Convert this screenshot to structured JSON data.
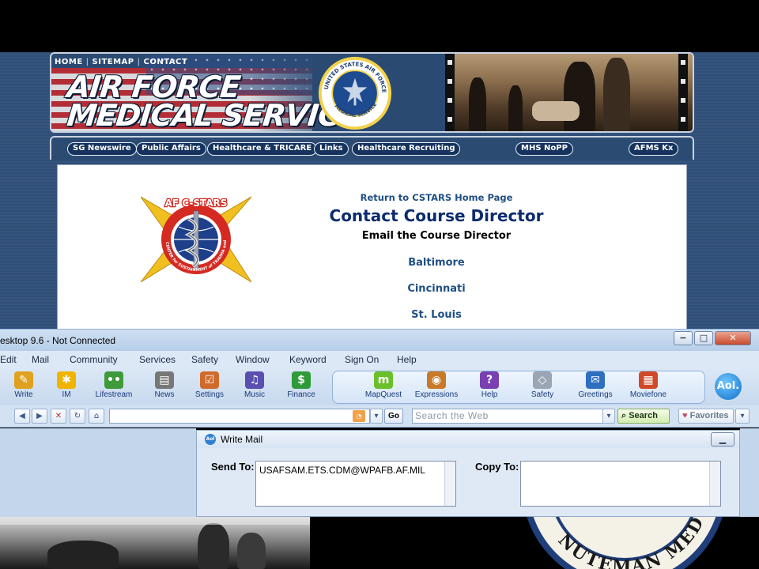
{
  "site": {
    "top_nav": [
      "HOME",
      "SITEMAP",
      "CONTACT"
    ],
    "brand_line1": "AIR FORCE",
    "brand_line2": "MEDICAL SERVICE",
    "seal_text": "UNITED STATES AIR FORCE · MEDICAL SERVICE",
    "nav_pills": [
      "SG Newswire",
      "Public Affairs",
      "Healthcare & TRICARE",
      "Links",
      "Healthcare Recruiting",
      "MHS NoPP",
      "AFMS Kx"
    ],
    "cstars_logo_text": "AF C-STARS",
    "cstars_ring_text": "CENTER for SUSTAINMENT of TRAUMA and READINESS SKILLS",
    "return_link": "Return to CSTARS Home Page",
    "contact_title": "Contact Course Director",
    "email_label": "Email the Course Director",
    "cities": [
      "Baltimore",
      "Cincinnati",
      "St. Louis"
    ]
  },
  "aol": {
    "title": "esktop 9.6 - Not Connected",
    "window_buttons": {
      "minimize": "−",
      "maximize": "□",
      "close": "✕"
    },
    "menu": [
      "Edit",
      "Mail",
      "Community",
      "Services",
      "Safety",
      "Window",
      "Keyword",
      "Sign On",
      "Help"
    ],
    "tools_left": [
      {
        "label": "Write",
        "icon": "write-icon",
        "color": "#e0a020",
        "glyph": "✎"
      },
      {
        "label": "IM",
        "icon": "running-man-icon",
        "color": "#f0b400",
        "glyph": "✱"
      },
      {
        "label": "Lifestream",
        "icon": "lifestream-icon",
        "color": "#3f9a3a",
        "glyph": "••"
      },
      {
        "label": "News",
        "icon": "news-icon",
        "color": "#777777",
        "glyph": "▤"
      },
      {
        "label": "Settings",
        "icon": "settings-icon",
        "color": "#d06a2a",
        "glyph": "☑"
      },
      {
        "label": "Music",
        "icon": "headphones-icon",
        "color": "#5a4fb0",
        "glyph": "♫"
      },
      {
        "label": "Finance",
        "icon": "finance-icon",
        "color": "#2f9a3a",
        "glyph": "$"
      }
    ],
    "tools_right": [
      {
        "label": "MapQuest",
        "icon": "mapquest-icon",
        "color": "#6bbf2a",
        "glyph": "m"
      },
      {
        "label": "Expressions",
        "icon": "palette-icon",
        "color": "#c87a2a",
        "glyph": "◉"
      },
      {
        "label": "Help",
        "icon": "help-icon",
        "color": "#7a3fb0",
        "glyph": "?"
      },
      {
        "label": "Safety",
        "icon": "shield-icon",
        "color": "#9aa6b4",
        "glyph": "◇"
      },
      {
        "label": "Greetings",
        "icon": "greetings-icon",
        "color": "#2f6fc0",
        "glyph": "✉"
      },
      {
        "label": "Moviefone",
        "icon": "popcorn-icon",
        "color": "#d04a2a",
        "glyph": "▦"
      }
    ],
    "logo": "Aol.",
    "go_label": "Go",
    "search_placeholder": "Search the Web",
    "search_button": "Search",
    "favorites_button": "Favorites",
    "write_mail": {
      "title": "Write Mail",
      "send_to_label": "Send To:",
      "send_to_value": "USAFSAM.ETS.CDM@WPAFB.AF.MIL",
      "copy_to_label": "Copy To:",
      "copy_to_value": ""
    }
  },
  "bottom_seal_text": "NUTEMAN MED"
}
